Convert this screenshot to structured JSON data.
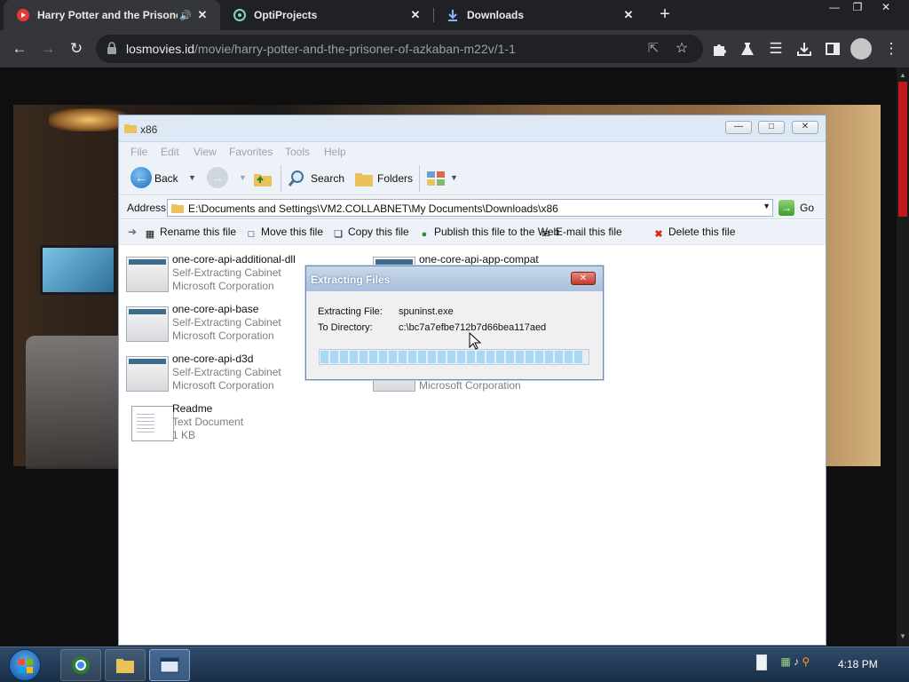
{
  "browser": {
    "tabs": [
      {
        "title": "Harry Potter and the Prisone",
        "active": true,
        "favicon": "movie-favicon"
      },
      {
        "title": "OptiProjects",
        "active": false,
        "favicon": "opti-favicon"
      },
      {
        "title": "Downloads",
        "active": false,
        "favicon": "download-icon"
      }
    ],
    "url_host": "losmovies.id",
    "url_path": "/movie/harry-potter-and-the-prisoner-of-azkaban-m22v/1-1"
  },
  "explorer": {
    "title": "x86",
    "menu": [
      "File",
      "Edit",
      "View",
      "Favorites",
      "Tools",
      "Help"
    ],
    "toolbar": {
      "back": "Back",
      "search": "Search",
      "folders": "Folders"
    },
    "address_label": "Address",
    "address_path": "E:\\Documents and Settings\\VM2.COLLABNET\\My Documents\\Downloads\\x86",
    "go_label": "Go",
    "tasks": [
      "Rename this file",
      "Move this file",
      "Copy this file",
      "Publish this file to the Web",
      "E-mail this file",
      "Delete this file"
    ],
    "files": [
      {
        "name": "one-core-api-additional-dll",
        "type": "Self-Extracting Cabinet",
        "detail": "Microsoft Corporation"
      },
      {
        "name": "one-core-api-base",
        "type": "Self-Extracting Cabinet",
        "detail": "Microsoft Corporation"
      },
      {
        "name": "one-core-api-d3d",
        "type": "Self-Extracting Cabinet",
        "detail": "Microsoft Corporation"
      },
      {
        "name": "Readme",
        "type": "Text Document",
        "detail": "1 KB"
      },
      {
        "name": "one-core-api-app-compat",
        "type": "",
        "detail": ""
      },
      {
        "name": "",
        "type": "",
        "detail": "Microsoft Corporation"
      }
    ]
  },
  "dialog": {
    "title": "Extracting Files",
    "file_label": "Extracting File:",
    "file_value": "spuninst.exe",
    "dir_label": "To Directory:",
    "dir_value": "c:\\bc7a7efbe712b7d66bea117aed",
    "progress": 0.98
  },
  "taskbar": {
    "clock": "4:18 PM"
  },
  "colors": {
    "accent_red": "#bf1b1b",
    "xp_blue": "#dfe9f5"
  }
}
